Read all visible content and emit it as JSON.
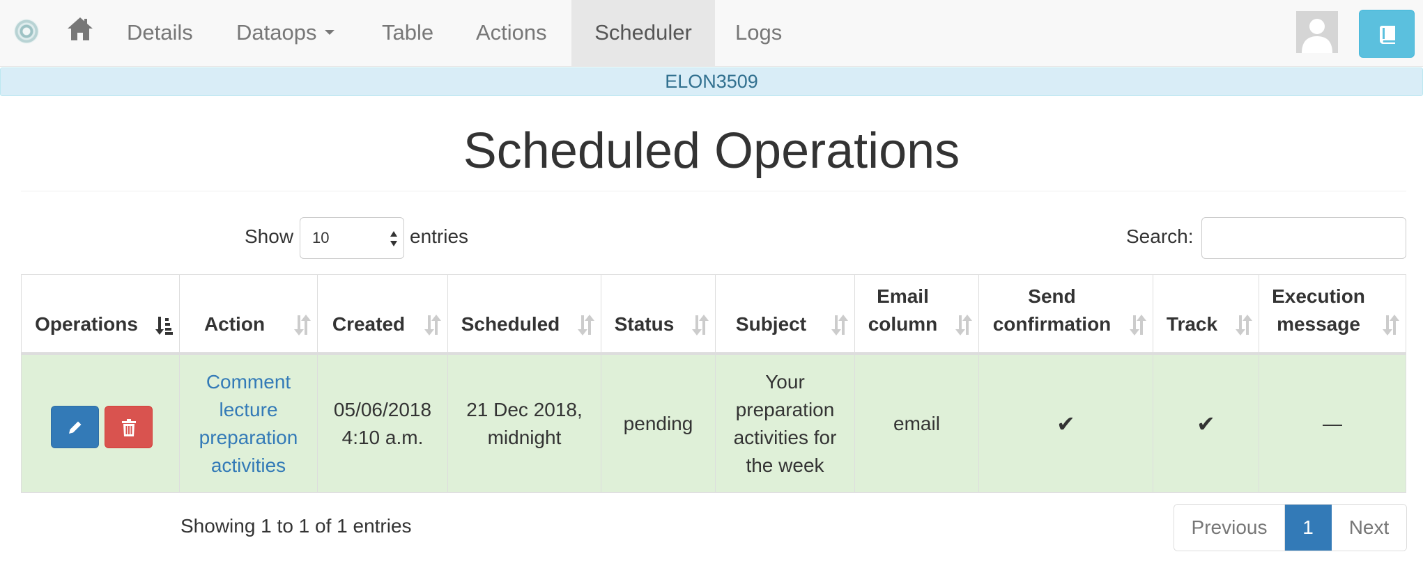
{
  "navbar": {
    "items": [
      {
        "label": "Details"
      },
      {
        "label": "Dataops"
      },
      {
        "label": "Table"
      },
      {
        "label": "Actions"
      },
      {
        "label": "Scheduler",
        "active": true
      },
      {
        "label": "Logs"
      }
    ]
  },
  "banner": {
    "workflow_name": "ELON3509"
  },
  "page_title": "Scheduled Operations",
  "controls": {
    "show_label": "Show",
    "page_length": "10",
    "entries_label": "entries",
    "search_label": "Search:",
    "search_value": ""
  },
  "table": {
    "headers": [
      "Operations",
      "Action",
      "Created",
      "Scheduled",
      "Status",
      "Subject",
      "Email column",
      "Send confirmation",
      "Track",
      "Execution message"
    ],
    "rows": [
      {
        "action": "Comment lecture preparation activities",
        "created": "05/06/2018 4:10 a.m.",
        "scheduled": "21 Dec 2018, midnight",
        "status": "pending",
        "subject": "Your preparation activities for the week",
        "email_column": "email",
        "send_confirmation": "✔",
        "track": "✔",
        "execution_message": "—"
      }
    ]
  },
  "footer": {
    "info": "Showing 1 to 1 of 1 entries",
    "previous": "Previous",
    "current_page": "1",
    "next": "Next"
  },
  "colors": {
    "primary": "#337ab7",
    "danger": "#d9534f",
    "info": "#5bc0de",
    "row_success": "#dff0d8",
    "banner": "#d9edf7"
  },
  "icons": [
    "brand-logo-icon",
    "home-icon",
    "caret-down-icon",
    "user-avatar-icon",
    "book-icon",
    "sort-icon",
    "pencil-icon",
    "trash-icon"
  ]
}
